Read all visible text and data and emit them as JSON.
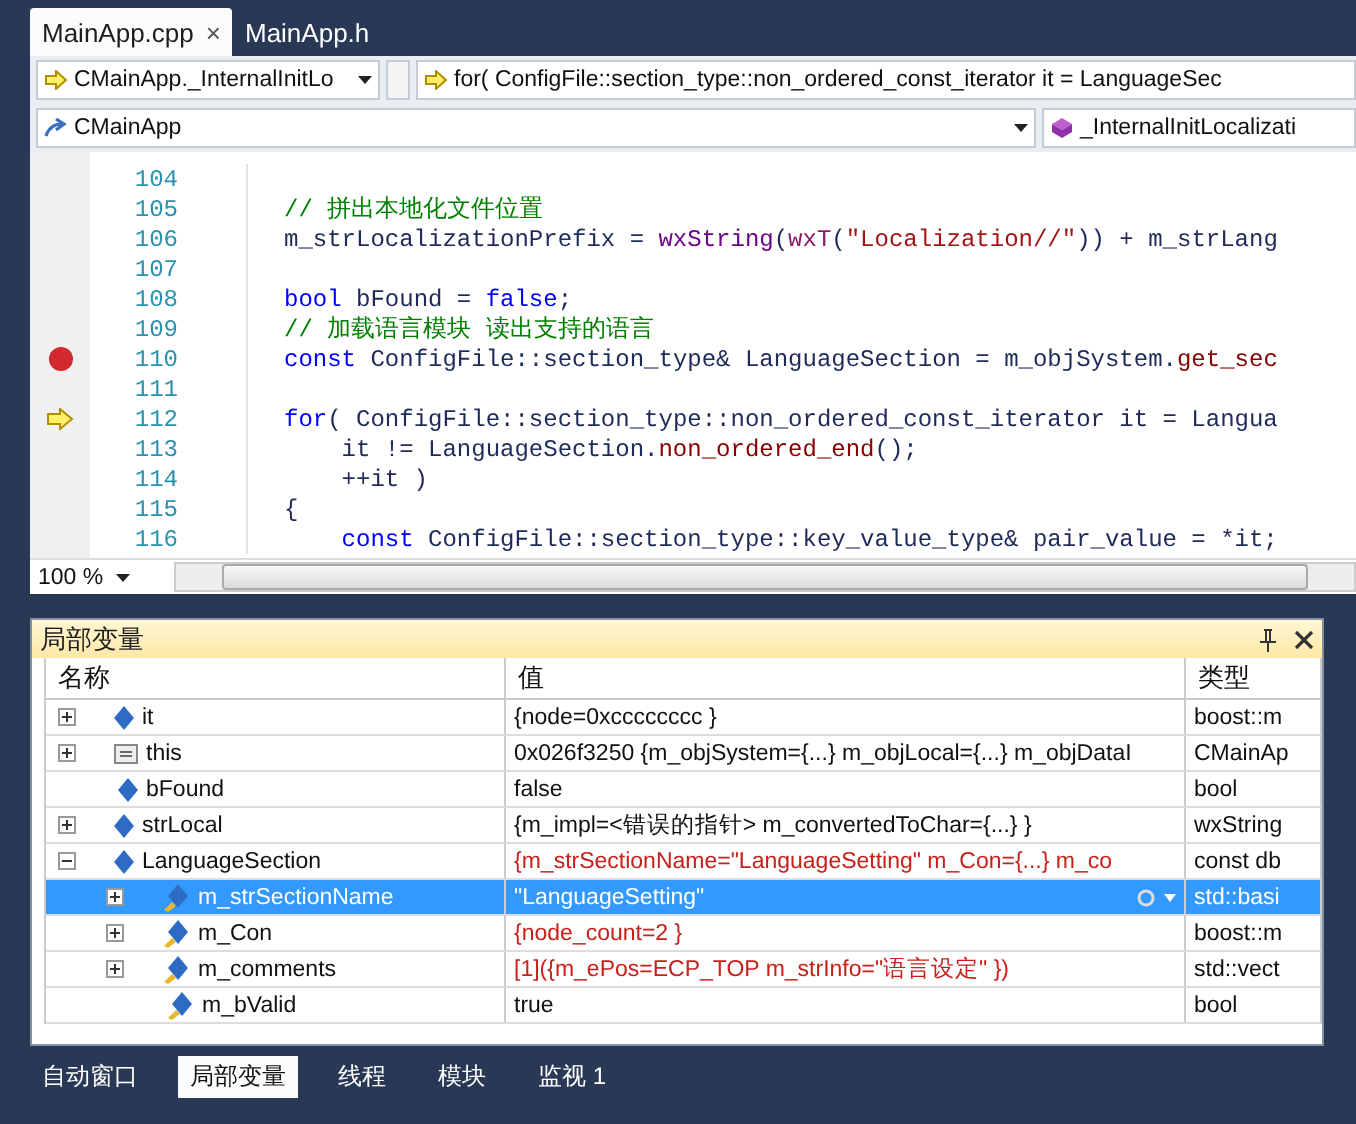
{
  "editor_tabs": [
    {
      "label": "MainApp.cpp",
      "selected": true,
      "close": "×"
    },
    {
      "label": "MainApp.h",
      "selected": false
    }
  ],
  "nav": {
    "scope": "CMainApp._InternalInitLo",
    "statement": "for( ConfigFile::section_type::non_ordered_const_iterator it = LanguageSec",
    "class": "CMainApp",
    "member": "_InternalInitLocalizati"
  },
  "code_lines": [
    {
      "number": "104",
      "kind": "plain"
    },
    {
      "number": "105",
      "kind": "plain",
      "tokens": [
        {
          "text": "// 拼出本地化文件位置",
          "kind": "comment"
        }
      ]
    },
    {
      "number": "106",
      "kind": "plain",
      "tokens": [
        {
          "text": "m_strLocalizationPrefix = ",
          "kind": "plain"
        },
        {
          "text": "wxString",
          "kind": "type"
        },
        {
          "text": "(",
          "kind": "plain"
        },
        {
          "text": "wxT",
          "kind": "macro"
        },
        {
          "text": "(",
          "kind": "plain"
        },
        {
          "text": "\"Localization//\"",
          "kind": "string"
        },
        {
          "text": ")) + m_strLang",
          "kind": "plain"
        }
      ]
    },
    {
      "number": "107",
      "kind": "plain"
    },
    {
      "number": "108",
      "kind": "plain",
      "tokens": [
        {
          "text": "bool",
          "kind": "keyword"
        },
        {
          "text": " bFound = ",
          "kind": "plain"
        },
        {
          "text": "false",
          "kind": "keyword"
        },
        {
          "text": ";",
          "kind": "plain"
        }
      ]
    },
    {
      "number": "109",
      "kind": "plain",
      "tokens": [
        {
          "text": "// 加载语言模块 读出支持的语言",
          "kind": "comment"
        }
      ]
    },
    {
      "number": "110",
      "kind": "breakpoint",
      "tokens": [
        {
          "text": "const",
          "kind": "keyword"
        },
        {
          "text": " ConfigFile::section_type& LanguageSection = m_objSystem.",
          "kind": "plain"
        },
        {
          "text": "get_sec",
          "kind": "function"
        }
      ]
    },
    {
      "number": "111",
      "kind": "plain"
    },
    {
      "number": "112",
      "kind": "current",
      "tokens": [
        {
          "text": "for",
          "kind": "keyword"
        },
        {
          "text": "( ConfigFile::section_type::non_ordered_const_iterator it = Langua",
          "kind": "plain"
        }
      ]
    },
    {
      "number": "113",
      "kind": "plain",
      "tokens": [
        {
          "text": "    it != LanguageSection.",
          "kind": "plain"
        },
        {
          "text": "non_ordered_end",
          "kind": "function"
        },
        {
          "text": "();",
          "kind": "plain"
        }
      ]
    },
    {
      "number": "114",
      "kind": "plain",
      "tokens": [
        {
          "text": "    ++it )",
          "kind": "plain"
        }
      ]
    },
    {
      "number": "115",
      "kind": "plain",
      "tokens": [
        {
          "text": "{",
          "kind": "plain"
        }
      ]
    },
    {
      "number": "116",
      "kind": "plain",
      "tokens": [
        {
          "text": "    const",
          "kind": "keyword"
        },
        {
          "text": " ConfigFile::section_type::key_value_type& pair_value = *it;",
          "kind": "plain"
        }
      ]
    }
  ],
  "zoom": "100 %",
  "locals": {
    "title": "局部变量",
    "columns": [
      "名称",
      "值",
      "类型"
    ],
    "rows": [
      {
        "name": "it",
        "value": "{node=0xcccccccc }",
        "type": "boost::m",
        "kind": "variable",
        "expandable": true,
        "expanded": false,
        "changed": false,
        "selected": false
      },
      {
        "name": "this",
        "value": "0x026f3250 {m_objSystem={...} m_objLocal={...} m_objDataI",
        "type": "CMainAp",
        "kind": "pointer",
        "expandable": true,
        "expanded": false,
        "changed": false,
        "selected": false
      },
      {
        "name": "bFound",
        "value": "false",
        "type": "bool",
        "kind": "variable",
        "changed": false,
        "selected": false
      },
      {
        "name": "strLocal",
        "value": "{m_impl=<错误的指针> m_convertedToChar={...} }",
        "type": "wxString",
        "kind": "variable",
        "expandable": true,
        "expanded": false,
        "changed": false,
        "selected": false
      },
      {
        "name": "LanguageSection",
        "value": "{m_strSectionName=\"LanguageSetting\" m_Con={...} m_co",
        "type": "const db",
        "kind": "variable",
        "expandable": true,
        "expanded": true,
        "changed": true,
        "selected": false,
        "children": [
          {
            "name": "m_strSectionName",
            "value": "\"LanguageSetting\"",
            "type": "std::basi",
            "kind": "member",
            "expandable": true,
            "expanded": false,
            "changed": true,
            "selected": true
          },
          {
            "name": "m_Con",
            "value": "{node_count=2 }",
            "type": "boost::m",
            "kind": "member",
            "expandable": true,
            "expanded": false,
            "changed": true,
            "selected": false
          },
          {
            "name": "m_comments",
            "value": "[1]({m_ePos=ECP_TOP m_strInfo=\"语言设定\" })",
            "type": "std::vect",
            "kind": "member",
            "expandable": true,
            "expanded": false,
            "changed": true,
            "selected": false
          },
          {
            "name": "m_bValid",
            "value": "true",
            "type": "bool",
            "kind": "member",
            "changed": false,
            "selected": false
          }
        ]
      }
    ]
  },
  "bottom_tabs": [
    {
      "label": "自动窗口",
      "selected": false
    },
    {
      "label": "局部变量",
      "selected": true
    },
    {
      "label": "线程",
      "selected": false
    },
    {
      "label": "模块",
      "selected": false
    },
    {
      "label": "监视 1",
      "selected": false
    }
  ]
}
